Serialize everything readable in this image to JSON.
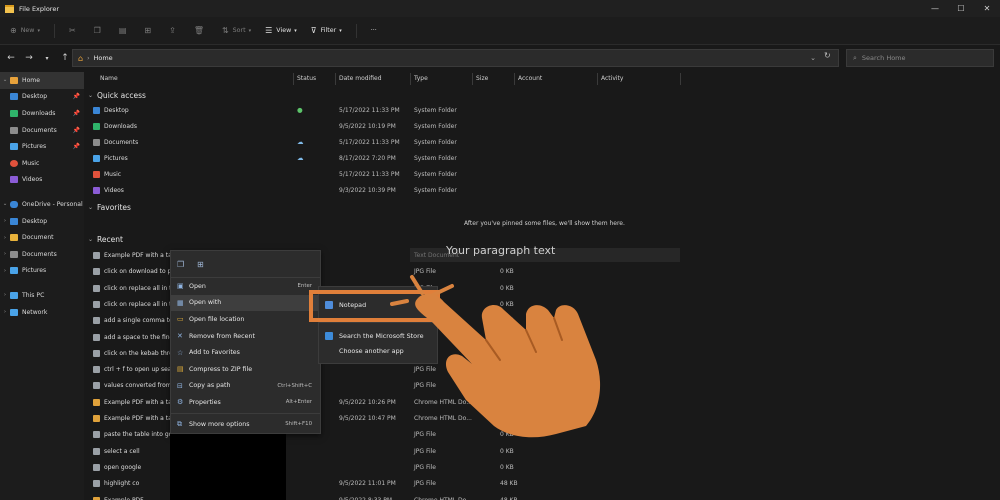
{
  "window": {
    "title": "File Explorer",
    "controls": [
      "—",
      "☐",
      "✕"
    ]
  },
  "cmdbar": {
    "new_label": "New",
    "sort_label": "Sort",
    "view_label": "View",
    "filter_label": "Filter",
    "more_label": "···"
  },
  "address": {
    "location": "Home",
    "search_placeholder": "Search Home"
  },
  "sidebar": {
    "items": [
      {
        "label": "Home",
        "icon": "home-icon",
        "color": "#e8a23b"
      },
      {
        "label": "Desktop",
        "icon": "desktop-icon",
        "color": "#3a86d6",
        "pinned": true
      },
      {
        "label": "Downloads",
        "icon": "download-icon",
        "color": "#2fb36a",
        "pinned": true
      },
      {
        "label": "Documents",
        "icon": "documents-icon",
        "color": "#8c8c8c",
        "pinned": true
      },
      {
        "label": "Pictures",
        "icon": "pictures-icon",
        "color": "#4aa3e8",
        "pinned": true
      },
      {
        "label": "Music",
        "icon": "music-icon",
        "color": "#e0523c"
      },
      {
        "label": "Videos",
        "icon": "videos-icon",
        "color": "#8b5cd6"
      },
      {
        "label": "OneDrive - Personal",
        "icon": "cloud-icon",
        "color": "#3a86d6"
      },
      {
        "label": "Desktop",
        "icon": "folder-icon",
        "color": "#3a86d6"
      },
      {
        "label": "Document",
        "icon": "folder-icon",
        "color": "#e8b23b"
      },
      {
        "label": "Documents",
        "icon": "folder-icon",
        "color": "#8c8c8c"
      },
      {
        "label": "Pictures",
        "icon": "folder-icon",
        "color": "#4aa3e8"
      },
      {
        "label": "This PC",
        "icon": "pc-icon",
        "color": "#4aa3e8"
      },
      {
        "label": "Network",
        "icon": "network-icon",
        "color": "#4aa3e8"
      }
    ]
  },
  "columns": {
    "name": "Name",
    "status": "Status",
    "date": "Date modified",
    "type": "Type",
    "size": "Size",
    "account": "Account",
    "activity": "Activity"
  },
  "sections": {
    "quick_access": "Quick access",
    "favorites": "Favorites",
    "recent": "Recent"
  },
  "quick_access": [
    {
      "name": "Desktop",
      "status": "●",
      "status_color": "#5cc36a",
      "date": "5/17/2022 11:33 PM",
      "type": "System Folder",
      "color": "#3a86d6"
    },
    {
      "name": "Downloads",
      "status": "",
      "status_color": "#7fb9e8",
      "date": "9/5/2022 10:19 PM",
      "type": "System Folder",
      "color": "#2fb36a"
    },
    {
      "name": "Documents",
      "status": "☁",
      "status_color": "#7fb9e8",
      "date": "5/17/2022 11:33 PM",
      "type": "System Folder",
      "color": "#8c8c8c"
    },
    {
      "name": "Pictures",
      "status": "☁",
      "status_color": "#7fb9e8",
      "date": "8/17/2022 7:20 PM",
      "type": "System Folder",
      "color": "#4aa3e8"
    },
    {
      "name": "Music",
      "status": "",
      "status_color": "#7fb9e8",
      "date": "5/17/2022 11:33 PM",
      "type": "System Folder",
      "color": "#e0523c"
    },
    {
      "name": "Videos",
      "status": "",
      "status_color": "#7fb9e8",
      "date": "9/3/2022 10:39 PM",
      "type": "System Folder",
      "color": "#8b5cd6"
    }
  ],
  "favorites_empty": "After you've pinned some files, we'll show them here.",
  "overlay_text": "Your paragraph text",
  "recent": [
    {
      "name": "Example PDF with a tabl",
      "date": "",
      "type": "Text Document",
      "size": "",
      "color": "#9aa0a6"
    },
    {
      "name": "click on download to pl",
      "date": "",
      "type": "JPG File",
      "size": "0 KB",
      "color": "#9aa0a6"
    },
    {
      "name": "click on replace all in th",
      "date": "",
      "type": "JPG File",
      "size": "0 KB",
      "color": "#9aa0a6"
    },
    {
      "name": "click on replace all in th",
      "date": "",
      "type": "JPG File",
      "size": "0 KB",
      "color": "#9aa0a6"
    },
    {
      "name": "add a single comma to",
      "date": "",
      "type": "JPG File",
      "size": "0 KB",
      "color": "#9aa0a6"
    },
    {
      "name": "add a space to the find",
      "date": "",
      "type": "JPG File",
      "size": "0 KB",
      "color": "#9aa0a6"
    },
    {
      "name": "click on the kebab thre",
      "date": "",
      "type": "JPG File",
      "size": "0 KB",
      "color": "#9aa0a6"
    },
    {
      "name": "ctrl + f to open up sear",
      "date": "",
      "type": "JPG File",
      "size": "0 KB",
      "color": "#9aa0a6"
    },
    {
      "name": "values converted from",
      "date": "",
      "type": "JPG File",
      "size": "0 KB",
      "color": "#9aa0a6"
    },
    {
      "name": "Example PDF with a tab",
      "date": "9/5/2022 10:26 PM",
      "type": "Chrome HTML Do...",
      "size": "42 KB",
      "color": "#e0a23b"
    },
    {
      "name": "Example PDF with a tab",
      "date": "9/5/2022 10:47 PM",
      "type": "Chrome HTML Do...",
      "size": "42 KB",
      "color": "#e0a23b"
    },
    {
      "name": "paste the table into goo",
      "date": "",
      "type": "JPG File",
      "size": "0 KB",
      "color": "#9aa0a6"
    },
    {
      "name": "select a cell",
      "date": "",
      "type": "JPG File",
      "size": "0 KB",
      "color": "#9aa0a6"
    },
    {
      "name": "open google",
      "date": "",
      "type": "JPG File",
      "size": "0 KB",
      "color": "#9aa0a6"
    },
    {
      "name": "highlight co",
      "date": "9/5/2022 11:01 PM",
      "type": "JPG File",
      "size": "48 KB",
      "color": "#9aa0a6"
    },
    {
      "name": "Example PDF",
      "date": "9/5/2022 8:33 PM",
      "type": "Chrome HTML Do...",
      "size": "48 KB",
      "color": "#e0a23b"
    }
  ],
  "context_menu": {
    "items": [
      {
        "label": "Open",
        "shortcut": "Enter",
        "icon": "open-icon"
      },
      {
        "label": "Open with",
        "shortcut": "›",
        "icon": "open-with-icon"
      },
      {
        "label": "Open file location",
        "shortcut": "",
        "icon": "folder-icon"
      },
      {
        "label": "Remove from Recent",
        "shortcut": "",
        "icon": "remove-icon"
      },
      {
        "label": "Add to Favorites",
        "shortcut": "",
        "icon": "star-icon"
      },
      {
        "label": "Compress to ZIP file",
        "shortcut": "",
        "icon": "zip-icon"
      },
      {
        "label": "Copy as path",
        "shortcut": "Ctrl+Shift+C",
        "icon": "copy-path-icon"
      },
      {
        "label": "Properties",
        "shortcut": "Alt+Enter",
        "icon": "properties-icon"
      },
      {
        "label": "Show more options",
        "shortcut": "Shift+F10",
        "icon": "more-options-icon"
      }
    ]
  },
  "submenu": {
    "notepad": "Notepad",
    "store": "Search the Microsoft Store",
    "another": "Choose another app"
  },
  "colors": {
    "highlight": "#e07f3a",
    "hand": "#d9833f"
  }
}
